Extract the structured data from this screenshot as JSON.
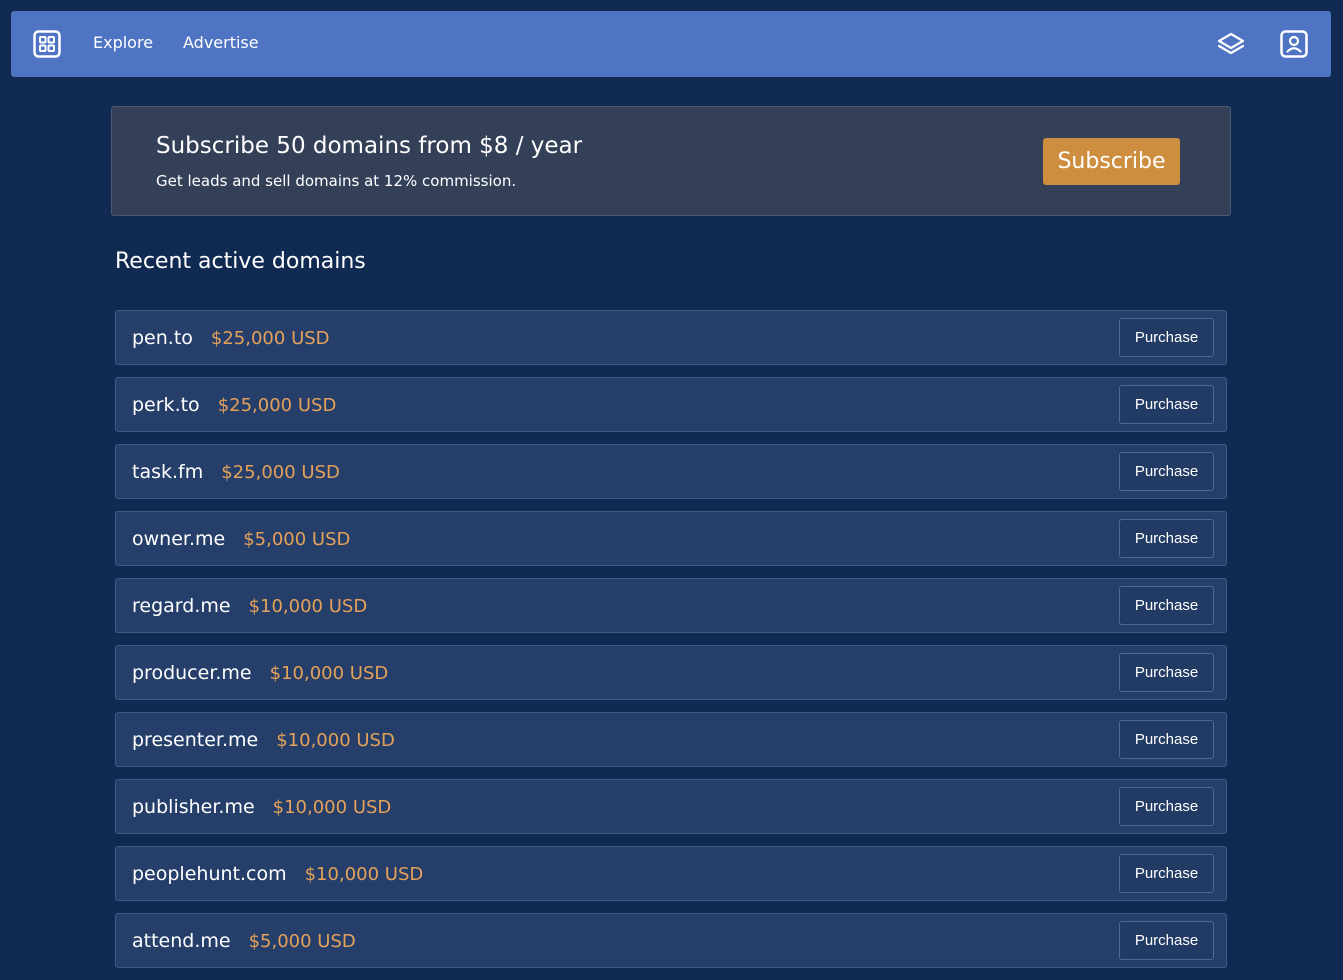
{
  "nav": {
    "logo_icon": "grid-icon",
    "links": [
      "Explore",
      "Advertise"
    ],
    "layers_icon": "layers-icon",
    "account_icon": "account-icon"
  },
  "promo": {
    "title": "Subscribe 50 domains from $8 / year",
    "subtitle": "Get leads and sell domains at 12% commission.",
    "button_label": "Subscribe"
  },
  "section_title": "Recent active domains",
  "domains": [
    {
      "name": "pen.to",
      "price": "$25,000 USD",
      "action": "Purchase"
    },
    {
      "name": "perk.to",
      "price": "$25,000 USD",
      "action": "Purchase"
    },
    {
      "name": "task.fm",
      "price": "$25,000 USD",
      "action": "Purchase"
    },
    {
      "name": "owner.me",
      "price": "$5,000 USD",
      "action": "Purchase"
    },
    {
      "name": "regard.me",
      "price": "$10,000 USD",
      "action": "Purchase"
    },
    {
      "name": "producer.me",
      "price": "$10,000 USD",
      "action": "Purchase"
    },
    {
      "name": "presenter.me",
      "price": "$10,000 USD",
      "action": "Purchase"
    },
    {
      "name": "publisher.me",
      "price": "$10,000 USD",
      "action": "Purchase"
    },
    {
      "name": "peoplehunt.com",
      "price": "$10,000 USD",
      "action": "Purchase"
    },
    {
      "name": "attend.me",
      "price": "$5,000 USD",
      "action": "Purchase"
    }
  ],
  "colors": {
    "background": "#102a52",
    "navbar": "#4f74c4",
    "promo": "#344058",
    "subscribe": "#cd8e3f",
    "row": "#263f6a",
    "price": "#e4a15a"
  }
}
